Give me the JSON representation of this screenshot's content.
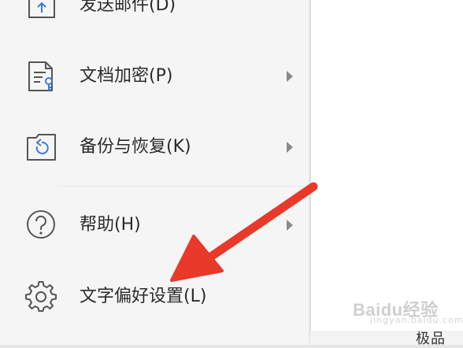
{
  "menu": {
    "items": [
      {
        "label": "发送邮件(D)",
        "icon": "send-mail-icon",
        "has_submenu": false
      },
      {
        "label": "文档加密(P)",
        "icon": "document-lock-icon",
        "has_submenu": true
      },
      {
        "label": "备份与恢复(K)",
        "icon": "backup-restore-icon",
        "has_submenu": true
      },
      {
        "label": "帮助(H)",
        "icon": "help-icon",
        "has_submenu": true
      },
      {
        "label": "文字偏好设置(L)",
        "icon": "gear-icon",
        "has_submenu": false
      }
    ]
  },
  "watermark": {
    "brand": "Baidu经验",
    "url": "jingyan.baidu.com"
  },
  "bottom_partial_text": "极品",
  "colors": {
    "menu_bg": "#f5f5f5",
    "icon_stroke": "#555555",
    "icon_accent": "#3a7bd5",
    "annotation_arrow": "#e8392b"
  }
}
